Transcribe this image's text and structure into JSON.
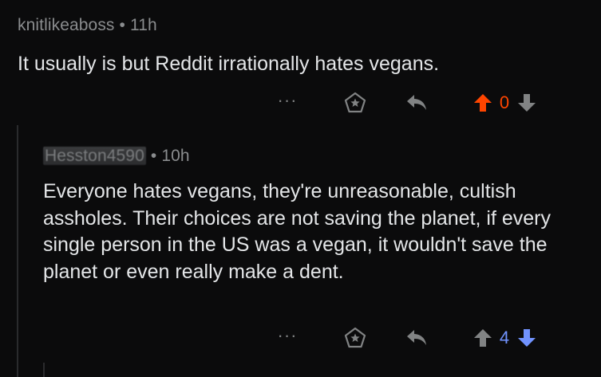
{
  "parent_comment": {
    "author": "knitlikeaboss",
    "separator": "•",
    "age": "11h",
    "text": "It usually is but Reddit irrationally hates vegans.",
    "score": "0",
    "more_label": "···"
  },
  "reply_comment": {
    "author": "Hesston4590",
    "separator": "•",
    "age": "10h",
    "text": "Everyone hates vegans, they're unreasonable, cultish assholes. Their choices are not saving the planet, if every single person in the US was a vegan, it wouldn't save the planet or even really make a dent.",
    "score": "4",
    "more_label": "···"
  },
  "colors": {
    "upvote_active": "#ff4500",
    "downvote_active": "#7193ff",
    "icon_default": "#818384"
  },
  "icons": {
    "award": "award-icon",
    "reply": "reply-icon",
    "upvote": "upvote-arrow-icon",
    "downvote": "downvote-arrow-icon",
    "more": "more-options-icon"
  }
}
